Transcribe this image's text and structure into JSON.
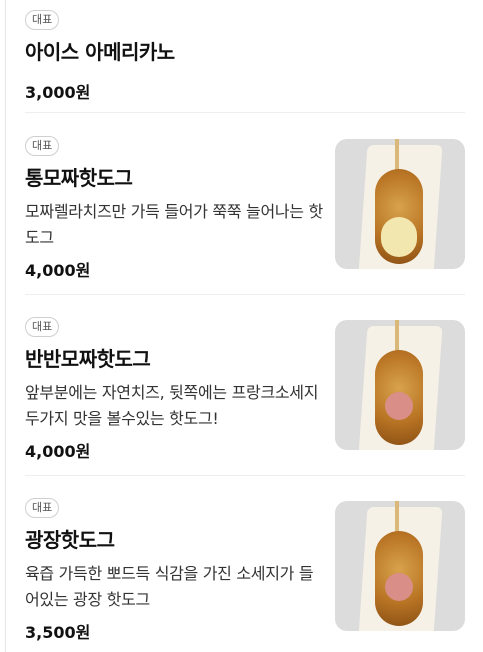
{
  "items": [
    {
      "badge": "대표",
      "name": "아이스 아메리카노",
      "desc": "",
      "price": "3,000원",
      "image": "none"
    },
    {
      "badge": "대표",
      "name": "통모짜핫도그",
      "desc": "모짜렐라치즈만 가득 들어가 쭉쭉 늘어나는 핫도그",
      "price": "4,000원",
      "image": "mozzarella-corndog"
    },
    {
      "badge": "대표",
      "name": "반반모짜핫도그",
      "desc": "앞부분에는 자연치즈, 뒷쪽에는 프랑크소세지 두가지 맛을 볼수있는 핫도그!",
      "price": "4,000원",
      "image": "half-half-corndog"
    },
    {
      "badge": "대표",
      "name": "광장핫도그",
      "desc": "육즙 가득한 뽀드득 식감을 가진 소세지가 들어있는 광장 핫도그",
      "price": "3,500원",
      "image": "sausage-corndog"
    }
  ]
}
